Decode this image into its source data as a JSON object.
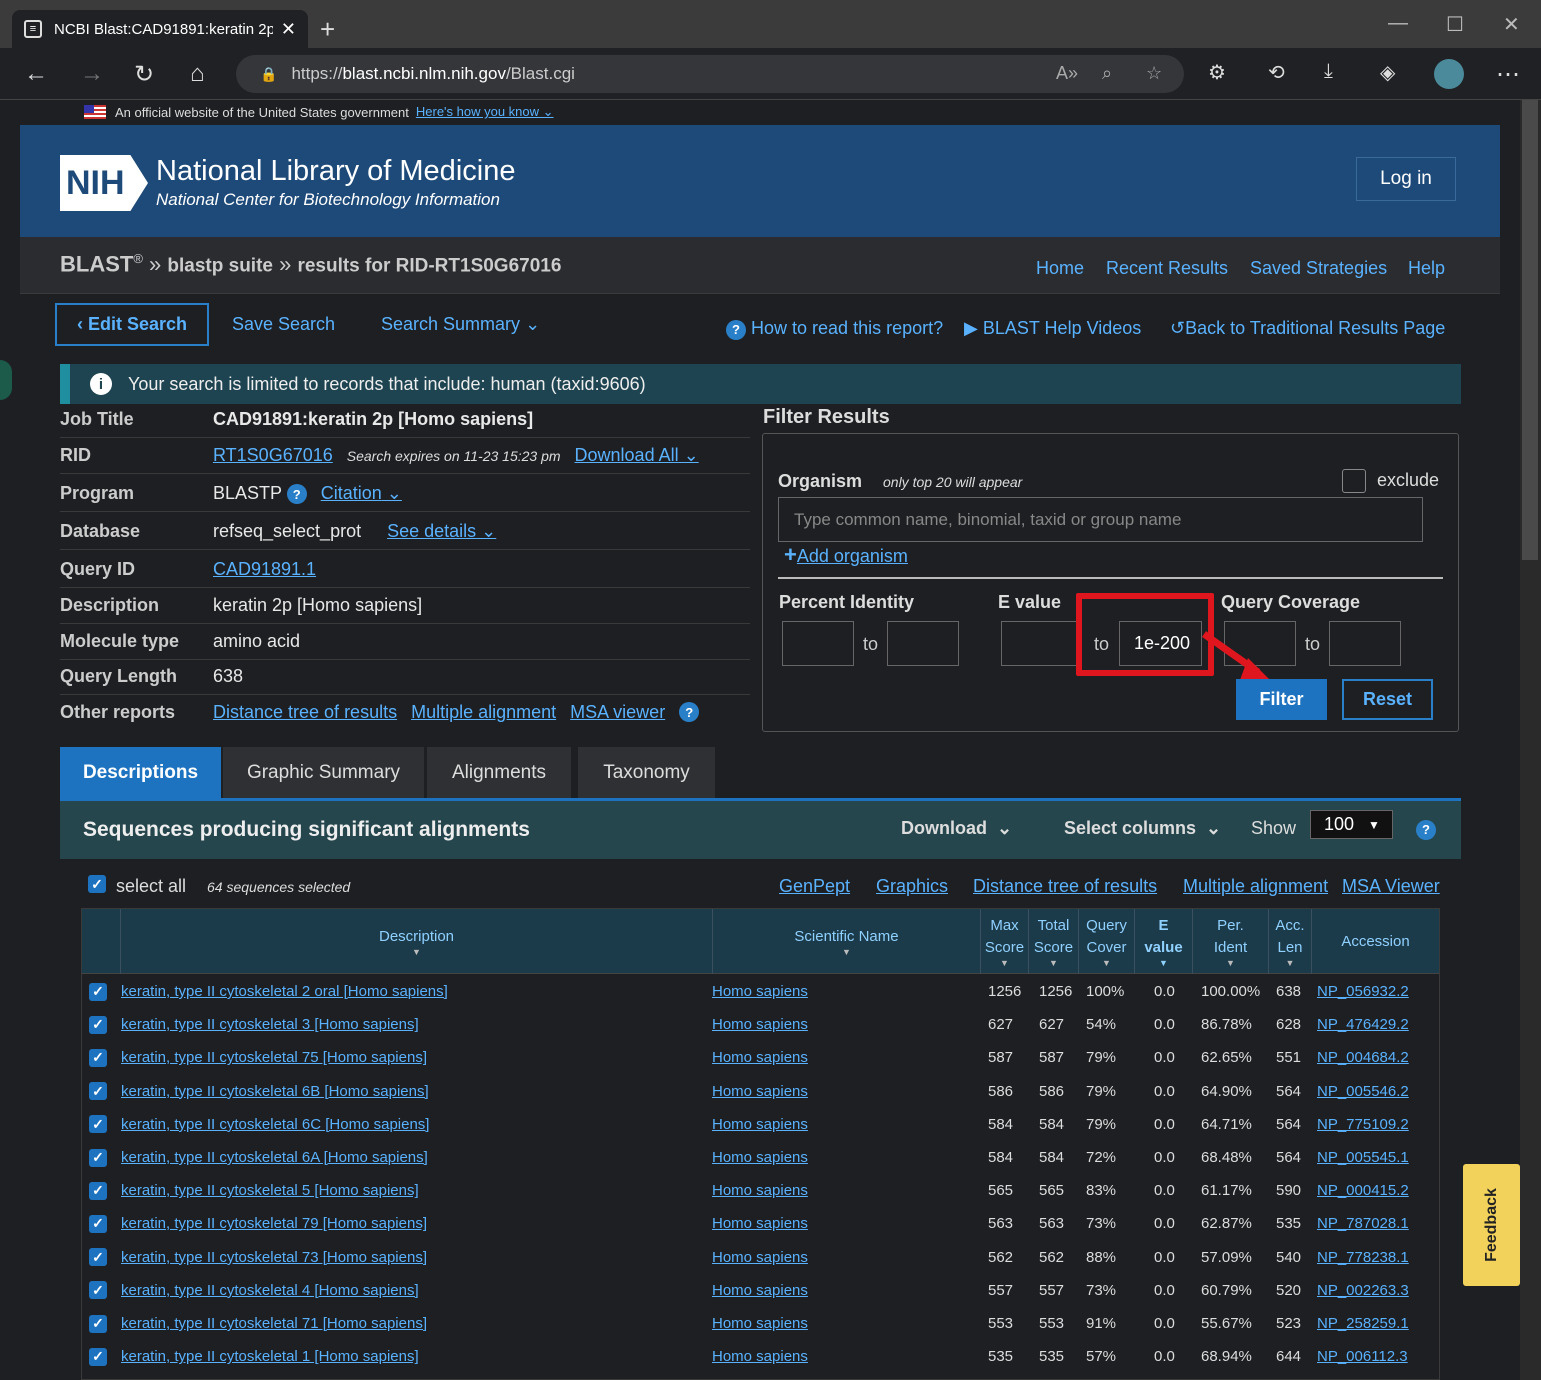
{
  "browser": {
    "tab_title": "NCBI Blast:CAD91891:keratin 2p",
    "url_prefix": "https://",
    "url_host": "blast.ncbi.nlm.nih.gov",
    "url_path": "/Blast.cgi"
  },
  "gov_banner": {
    "text": "An official website of the United States government",
    "link": "Here's how you know"
  },
  "header": {
    "logo": "NIH",
    "title": "National Library of Medicine",
    "subtitle": "National Center for Biotechnology Information",
    "login": "Log in"
  },
  "breadcrumb": {
    "blast": "BLAST",
    "reg": "®",
    "sep1": " » ",
    "suite": "blastp suite",
    "sep2": " » ",
    "results": "results for RID-RT1S0G67016"
  },
  "topnav": [
    "Home",
    "Recent Results",
    "Saved Strategies",
    "Help"
  ],
  "toolbar": {
    "edit": "Edit Search",
    "save": "Save Search",
    "summary": "Search Summary",
    "how": "How to read this report?",
    "videos": "BLAST Help Videos",
    "back": "Back to Traditional Results Page"
  },
  "info": "Your search is limited to records that include: human (taxid:9606)",
  "job": {
    "title_k": "Job Title",
    "title_v": "CAD91891:keratin 2p [Homo sapiens]",
    "rid_k": "RID",
    "rid_v": "RT1S0G67016",
    "rid_exp": "Search expires on 11-23 15:23 pm",
    "rid_dl": "Download All",
    "prog_k": "Program",
    "prog_v": "BLASTP",
    "prog_cit": "Citation",
    "db_k": "Database",
    "db_v": "refseq_select_prot",
    "db_see": "See details",
    "qid_k": "Query ID",
    "qid_v": "CAD91891.1",
    "desc_k": "Description",
    "desc_v": "keratin 2p [Homo sapiens]",
    "mol_k": "Molecule type",
    "mol_v": "amino acid",
    "len_k": "Query Length",
    "len_v": "638",
    "other_k": "Other reports",
    "other_1": "Distance tree of results",
    "other_2": "Multiple alignment",
    "other_3": "MSA viewer"
  },
  "filter": {
    "title": "Filter Results",
    "organism": "Organism",
    "org_note": "only top 20 will appear",
    "exclude": "exclude",
    "org_placeholder": "Type common  name, binomial, taxid or group  name",
    "add_org": "Add organism",
    "pi": "Percent Identity",
    "ev": "E value",
    "qc": "Query Coverage",
    "to": "to",
    "ev_to_value": "1e-200",
    "filter": "Filter",
    "reset": "Reset"
  },
  "tabs": [
    "Descriptions",
    "Graphic Summary",
    "Alignments",
    "Taxonomy"
  ],
  "seq": {
    "title": "Sequences producing significant alignments",
    "download": "Download",
    "select_columns": "Select columns",
    "show": "Show",
    "show_value": "100"
  },
  "select": {
    "all": "select all",
    "count": "64 sequences selected",
    "links": [
      "GenPept",
      "Graphics",
      "Distance tree of results",
      "Multiple alignment",
      "MSA Viewer"
    ]
  },
  "columns": {
    "desc": "Description",
    "sci": "Scientific Name",
    "max1": "Max",
    "max2": "Score",
    "tot1": "Total",
    "tot2": "Score",
    "qc1": "Query",
    "qc2": "Cover",
    "ev1": "E",
    "ev2": "value",
    "pi1": "Per.",
    "pi2": "Ident",
    "acc1": "Acc.",
    "acc2": "Len",
    "accession": "Accession"
  },
  "rows": [
    {
      "desc": "keratin, type II cytoskeletal 2 oral [Homo sapiens]",
      "sci": "Homo sapiens",
      "max": "1256",
      "tot": "1256",
      "qc": "100%",
      "ev": "0.0",
      "pi": "100.00%",
      "len": "638",
      "acc": "NP_056932.2"
    },
    {
      "desc": "keratin, type II cytoskeletal 3 [Homo sapiens]",
      "sci": "Homo sapiens",
      "max": "627",
      "tot": "627",
      "qc": "54%",
      "ev": "0.0",
      "pi": "86.78%",
      "len": "628",
      "acc": "NP_476429.2"
    },
    {
      "desc": "keratin, type II cytoskeletal 75 [Homo sapiens]",
      "sci": "Homo sapiens",
      "max": "587",
      "tot": "587",
      "qc": "79%",
      "ev": "0.0",
      "pi": "62.65%",
      "len": "551",
      "acc": "NP_004684.2"
    },
    {
      "desc": "keratin, type II cytoskeletal 6B [Homo sapiens]",
      "sci": "Homo sapiens",
      "max": "586",
      "tot": "586",
      "qc": "79%",
      "ev": "0.0",
      "pi": "64.90%",
      "len": "564",
      "acc": "NP_005546.2"
    },
    {
      "desc": "keratin, type II cytoskeletal 6C [Homo sapiens]",
      "sci": "Homo sapiens",
      "max": "584",
      "tot": "584",
      "qc": "79%",
      "ev": "0.0",
      "pi": "64.71%",
      "len": "564",
      "acc": "NP_775109.2"
    },
    {
      "desc": "keratin, type II cytoskeletal 6A [Homo sapiens]",
      "sci": "Homo sapiens",
      "max": "584",
      "tot": "584",
      "qc": "72%",
      "ev": "0.0",
      "pi": "68.48%",
      "len": "564",
      "acc": "NP_005545.1"
    },
    {
      "desc": "keratin, type II cytoskeletal 5 [Homo sapiens]",
      "sci": "Homo sapiens",
      "max": "565",
      "tot": "565",
      "qc": "83%",
      "ev": "0.0",
      "pi": "61.17%",
      "len": "590",
      "acc": "NP_000415.2"
    },
    {
      "desc": "keratin, type II cytoskeletal 79 [Homo sapiens]",
      "sci": "Homo sapiens",
      "max": "563",
      "tot": "563",
      "qc": "73%",
      "ev": "0.0",
      "pi": "62.87%",
      "len": "535",
      "acc": "NP_787028.1"
    },
    {
      "desc": "keratin, type II cytoskeletal 73 [Homo sapiens]",
      "sci": "Homo sapiens",
      "max": "562",
      "tot": "562",
      "qc": "88%",
      "ev": "0.0",
      "pi": "57.09%",
      "len": "540",
      "acc": "NP_778238.1"
    },
    {
      "desc": "keratin, type II cytoskeletal 4 [Homo sapiens]",
      "sci": "Homo sapiens",
      "max": "557",
      "tot": "557",
      "qc": "73%",
      "ev": "0.0",
      "pi": "60.79%",
      "len": "520",
      "acc": "NP_002263.3"
    },
    {
      "desc": "keratin, type II cytoskeletal 71 [Homo sapiens]",
      "sci": "Homo sapiens",
      "max": "553",
      "tot": "553",
      "qc": "91%",
      "ev": "0.0",
      "pi": "55.67%",
      "len": "523",
      "acc": "NP_258259.1"
    },
    {
      "desc": "keratin, type II cytoskeletal 1 [Homo sapiens]",
      "sci": "Homo sapiens",
      "max": "535",
      "tot": "535",
      "qc": "57%",
      "ev": "0.0",
      "pi": "68.94%",
      "len": "644",
      "acc": "NP_006112.3"
    }
  ],
  "feedback": "Feedback",
  "colors": {
    "accent": "#1e73c0",
    "link": "#5ab2ff",
    "header": "#1e4a79",
    "highlight": "#e0161e"
  }
}
